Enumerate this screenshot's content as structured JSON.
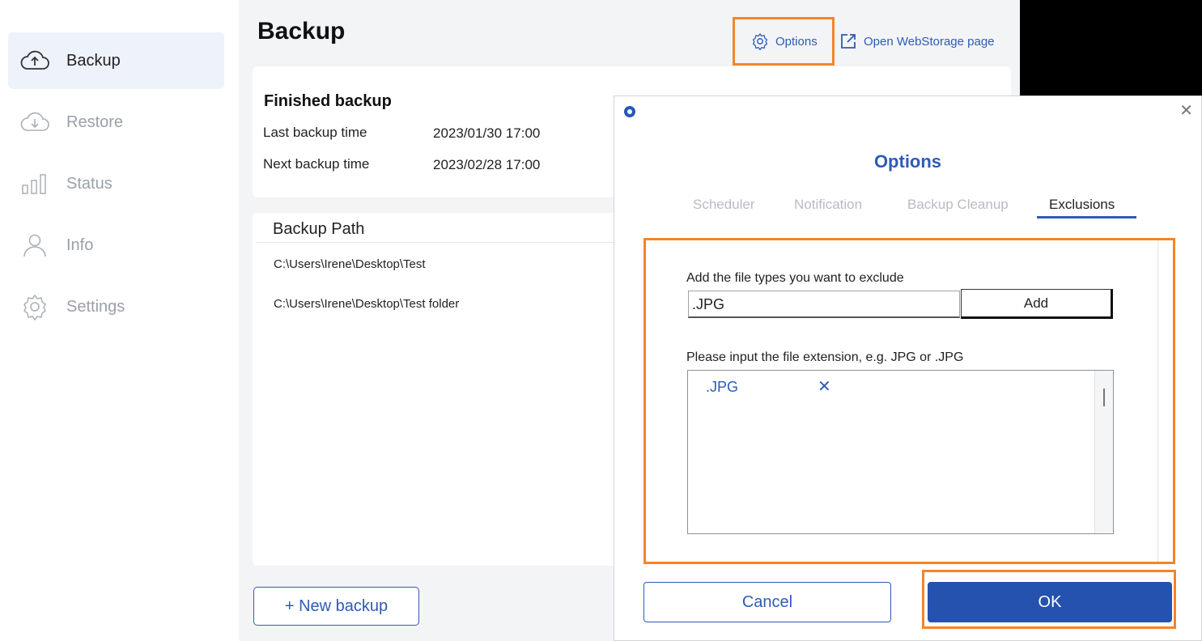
{
  "sidebar": {
    "items": [
      {
        "label": "Backup",
        "icon": "cloud-upload-icon",
        "active": true
      },
      {
        "label": "Restore",
        "icon": "cloud-download-icon",
        "active": false
      },
      {
        "label": "Status",
        "icon": "bar-chart-icon",
        "active": false
      },
      {
        "label": "Info",
        "icon": "user-icon",
        "active": false
      },
      {
        "label": "Settings",
        "icon": "gear-icon",
        "active": false
      }
    ]
  },
  "main": {
    "title": "Backup",
    "options_link": "Options",
    "webstorage_link": "Open WebStorage page",
    "status_card": {
      "heading": "Finished backup",
      "last_label": "Last backup time",
      "last_value": "2023/01/30 17:00",
      "next_label": "Next backup time",
      "next_value": "2023/02/28 17:00"
    },
    "path_card": {
      "heading": "Backup Path",
      "paths": [
        "C:\\Users\\Irene\\Desktop\\Test",
        "C:\\Users\\Irene\\Desktop\\Test folder"
      ]
    },
    "new_backup_label": "+ New backup"
  },
  "dialog": {
    "title": "Options",
    "tabs": [
      "Scheduler",
      "Notification",
      "Backup Cleanup",
      "Exclusions"
    ],
    "active_tab": "Exclusions",
    "add_label": "Add the file types you want to exclude",
    "input_value": ".JPG",
    "add_button": "Add",
    "hint": "Please input the file extension, e.g. JPG or .JPG",
    "excluded": [
      ".JPG"
    ],
    "remove_glyph": "✕",
    "close_glyph": "✕",
    "cancel": "Cancel",
    "ok": "OK"
  },
  "colors": {
    "accent": "#2f5bb5",
    "highlight": "#f0862a",
    "ok_bg": "#2452ae"
  }
}
